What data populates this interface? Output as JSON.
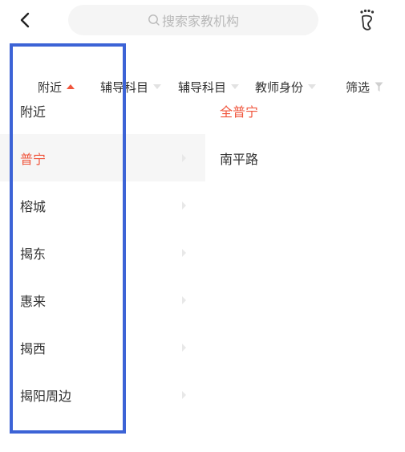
{
  "header": {
    "back_icon": "chevron-left-icon",
    "search_placeholder": "搜索家教机构",
    "search_icon": "search-icon",
    "footprint_icon": "footprint-icon"
  },
  "filters": [
    {
      "label": "附近",
      "state": "active"
    },
    {
      "label": "辅导科目",
      "state": "collapsed"
    },
    {
      "label": "辅导科目",
      "state": "collapsed"
    },
    {
      "label": "教师身份",
      "state": "collapsed"
    },
    {
      "label": "筛选",
      "icon": "funnel-icon"
    }
  ],
  "left_list": [
    {
      "label": "附近"
    },
    {
      "label": "普宁",
      "selected": true
    },
    {
      "label": "榕城"
    },
    {
      "label": "揭东"
    },
    {
      "label": "惠来"
    },
    {
      "label": "揭西"
    },
    {
      "label": "揭阳周边"
    }
  ],
  "right_list": [
    {
      "label": "全普宁",
      "selected": true
    },
    {
      "label": "南平路"
    }
  ],
  "colors": {
    "accent": "#f0563d",
    "highlight_box": "#3c63d6",
    "selected_bg": "#f6f6f6",
    "placeholder": "#b9b9b9"
  }
}
